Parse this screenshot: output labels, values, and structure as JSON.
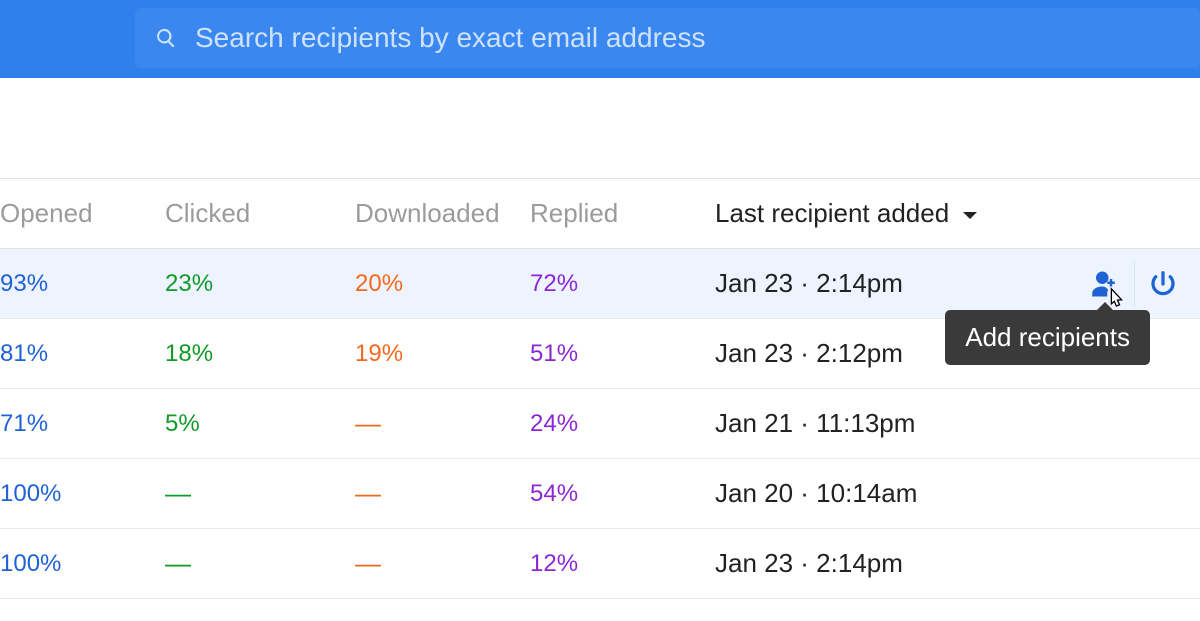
{
  "search": {
    "placeholder": "Search recipients by exact email address"
  },
  "columns": {
    "opened": "Opened",
    "clicked": "Clicked",
    "downloaded": "Downloaded",
    "replied": "Replied",
    "last": "Last recipient added"
  },
  "tooltip": {
    "add_recipients": "Add recipients"
  },
  "rows": [
    {
      "opened": "93%",
      "clicked": "23%",
      "downloaded": "20%",
      "replied": "72%",
      "last": "Jan 23 · 2:14pm",
      "active": true
    },
    {
      "opened": "81%",
      "clicked": "18%",
      "downloaded": "19%",
      "replied": "51%",
      "last": "Jan 23 · 2:12pm",
      "active": false
    },
    {
      "opened": "71%",
      "clicked": "5%",
      "downloaded": "—",
      "replied": "24%",
      "last": "Jan 21 · 11:13pm",
      "active": false
    },
    {
      "opened": "100%",
      "clicked": "—",
      "downloaded": "—",
      "replied": "54%",
      "last": "Jan 20 · 10:14am",
      "active": false
    },
    {
      "opened": "100%",
      "clicked": "—",
      "downloaded": "—",
      "replied": "12%",
      "last": "Jan 23 · 2:14pm",
      "active": false
    }
  ]
}
